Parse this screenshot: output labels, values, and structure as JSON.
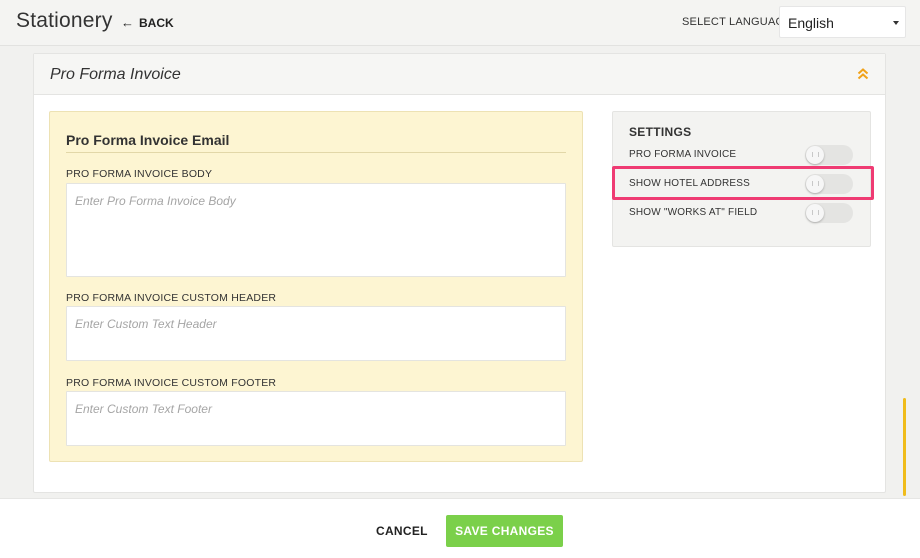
{
  "header": {
    "title": "Stationery",
    "back_label": "BACK",
    "language_label": "SELECT LANGUAGE",
    "language_value": "English"
  },
  "panel": {
    "title": "Pro Forma Invoice",
    "email": {
      "heading": "Pro Forma Invoice Email",
      "fields": [
        {
          "label": "PRO FORMA INVOICE BODY",
          "placeholder": "Enter Pro Forma Invoice Body"
        },
        {
          "label": "PRO FORMA INVOICE CUSTOM HEADER",
          "placeholder": "Enter Custom Text Header"
        },
        {
          "label": "PRO FORMA INVOICE CUSTOM FOOTER",
          "placeholder": "Enter Custom Text Footer"
        }
      ]
    },
    "settings": {
      "heading": "SETTINGS",
      "items": [
        {
          "label": "PRO FORMA INVOICE",
          "enabled": false
        },
        {
          "label": "SHOW HOTEL ADDRESS",
          "enabled": false,
          "highlighted": true
        },
        {
          "label": "SHOW \"WORKS AT\" FIELD",
          "enabled": false
        }
      ]
    }
  },
  "footer": {
    "cancel_label": "CANCEL",
    "save_label": "SAVE CHANGES"
  },
  "colors": {
    "accent_orange": "#f0a21a",
    "save_green": "#7bd04a",
    "highlight_pink": "#ef3b73",
    "card_yellow": "#fdf5d2"
  },
  "icons": {
    "back": "arrow-left-icon",
    "language_dropdown": "caret-down-icon",
    "collapse": "double-chevron-up-icon",
    "toggle_knob": "toggle-grip-icon"
  }
}
